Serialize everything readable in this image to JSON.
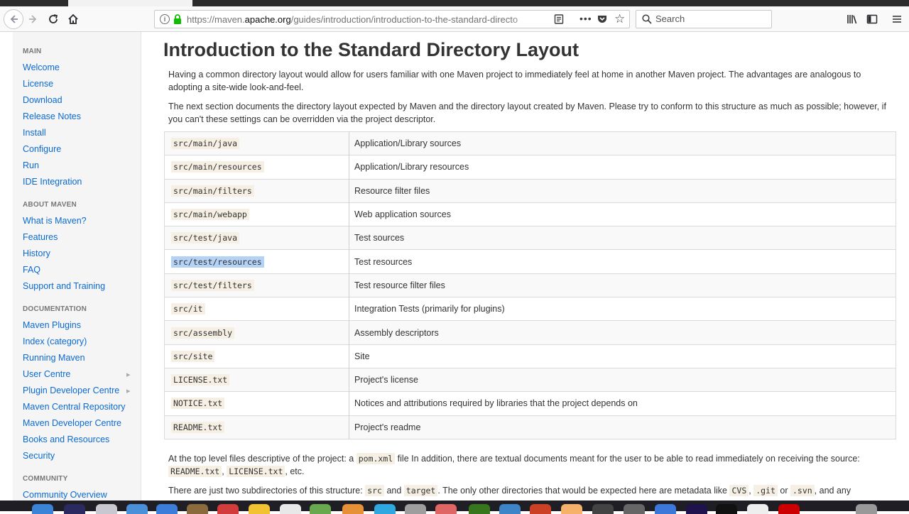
{
  "browser": {
    "url_prefix": "https://maven.",
    "url_host": "apache.org",
    "url_rest": "/guides/introduction/introduction-to-the-standard-directo",
    "search_placeholder": "Search"
  },
  "sidebar": {
    "sections": [
      {
        "header": "MAIN",
        "items": [
          "Welcome",
          "License",
          "Download",
          "Release Notes",
          "Install",
          "Configure",
          "Run",
          "IDE Integration"
        ]
      },
      {
        "header": "ABOUT MAVEN",
        "items": [
          "What is Maven?",
          "Features",
          "History",
          "FAQ",
          "Support and Training"
        ]
      },
      {
        "header": "DOCUMENTATION",
        "items": [
          "Maven Plugins",
          "Index (category)",
          "Running Maven",
          "User Centre",
          "Plugin Developer Centre",
          "Maven Central Repository",
          "Maven Developer Centre",
          "Books and Resources",
          "Security"
        ]
      },
      {
        "header": "COMMUNITY",
        "items": [
          "Community Overview"
        ]
      }
    ]
  },
  "page": {
    "title": "Introduction to the Standard Directory Layout",
    "para1": "Having a common directory layout would allow for users familiar with one Maven project to immediately feel at home in another Maven project. The advantages are analogous to adopting a site-wide look-and-feel.",
    "para2": "The next section documents the directory layout expected by Maven and the directory layout created by Maven. Please try to conform to this structure as much as possible; however, if you can't these settings can be overridden via the project descriptor.",
    "table": [
      {
        "path": "src/main/java",
        "desc": "Application/Library sources"
      },
      {
        "path": "src/main/resources",
        "desc": "Application/Library resources"
      },
      {
        "path": "src/main/filters",
        "desc": "Resource filter files"
      },
      {
        "path": "src/main/webapp",
        "desc": "Web application sources"
      },
      {
        "path": "src/test/java",
        "desc": "Test sources"
      },
      {
        "path": "src/test/resources",
        "desc": "Test resources"
      },
      {
        "path": "src/test/filters",
        "desc": "Test resource filter files"
      },
      {
        "path": "src/it",
        "desc": "Integration Tests (primarily for plugins)"
      },
      {
        "path": "src/assembly",
        "desc": "Assembly descriptors"
      },
      {
        "path": "src/site",
        "desc": "Site"
      },
      {
        "path": "LICENSE.txt",
        "desc": "Project's license"
      },
      {
        "path": "NOTICE.txt",
        "desc": "Notices and attributions required by libraries that the project depends on"
      },
      {
        "path": "README.txt",
        "desc": "Project's readme"
      }
    ],
    "para3": {
      "t1": "At the top level files descriptive of the project: a ",
      "c1": "pom.xml",
      "t2": " file In addition, there are textual documents meant for the user to be able to read immediately on receiving the source: ",
      "c2": "README.txt",
      "t3": ", ",
      "c3": "LICENSE.txt",
      "t4": ", etc."
    },
    "para4": {
      "t1": "There are just two subdirectories of this structure: ",
      "c1": "src",
      "t2": " and ",
      "c2": "target",
      "t3": ". The only other directories that would be expected here are metadata like ",
      "c3": "CVS",
      "t4": ", ",
      "c4": ".git",
      "t5": " or ",
      "c5": ".svn",
      "t6": ", and any"
    }
  },
  "colors": {
    "link": "#0a6ad2",
    "code_bg": "#f6efe3",
    "selection": "#b4d2f5"
  }
}
